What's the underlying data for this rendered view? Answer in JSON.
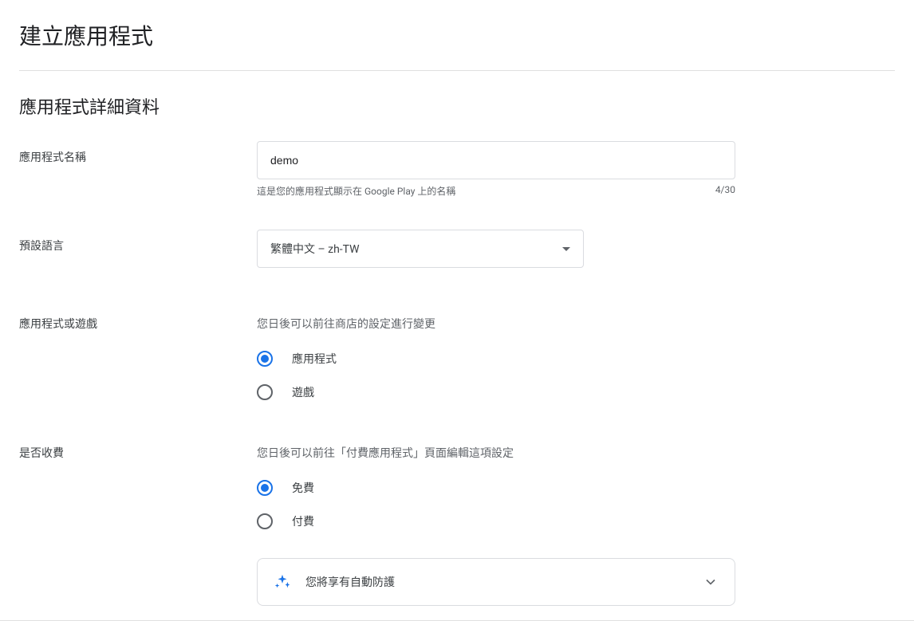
{
  "page": {
    "title": "建立應用程式",
    "section_title": "應用程式詳細資料"
  },
  "app_name": {
    "label": "應用程式名稱",
    "value": "demo",
    "helper": "這是您的應用程式顯示在 Google Play 上的名稱",
    "counter": "4/30"
  },
  "language": {
    "label": "預設語言",
    "selected": "繁體中文 – zh-TW"
  },
  "app_or_game": {
    "label": "應用程式或遊戲",
    "hint": "您日後可以前往商店的設定進行變更",
    "options": {
      "app": "應用程式",
      "game": "遊戲"
    }
  },
  "paid": {
    "label": "是否收費",
    "hint": "您日後可以前往「付費應用程式」頁面編輯這項設定",
    "options": {
      "free": "免費",
      "paid": "付費"
    }
  },
  "protection_card": {
    "title": "您將享有自動防護"
  }
}
